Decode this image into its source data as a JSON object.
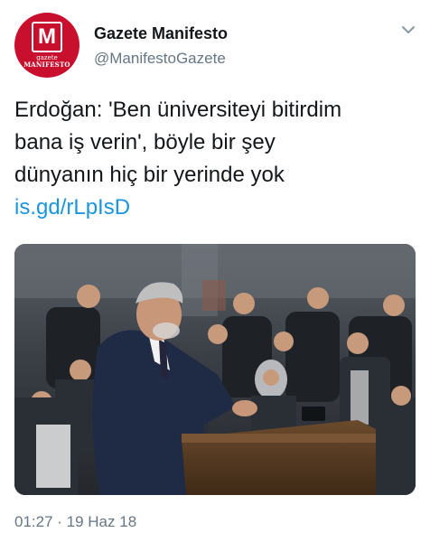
{
  "tweet": {
    "display_name": "Gazete Manifesto",
    "handle": "@ManifestoGazete",
    "avatar": {
      "letter": "M",
      "subline1": "gazete",
      "subline2": "MANIFESTO",
      "color": "#c8102e"
    },
    "text_lines": [
      "Erdoğan: 'Ben üniversiteyi bitirdim",
      "bana iş verin', böyle bir şey",
      "dünyanın hiç bir yerinde yok"
    ],
    "link": "is.gd/rLpIsD",
    "timestamp": "01:27 · 19 Haz 18",
    "menu_icon": "chevron-down-icon",
    "media": "photo of a speaker at a lectern addressing a seated young audience"
  },
  "colors": {
    "text": "#14171a",
    "secondary": "#657786",
    "link": "#1b95e0",
    "brand": "#c8102e"
  }
}
